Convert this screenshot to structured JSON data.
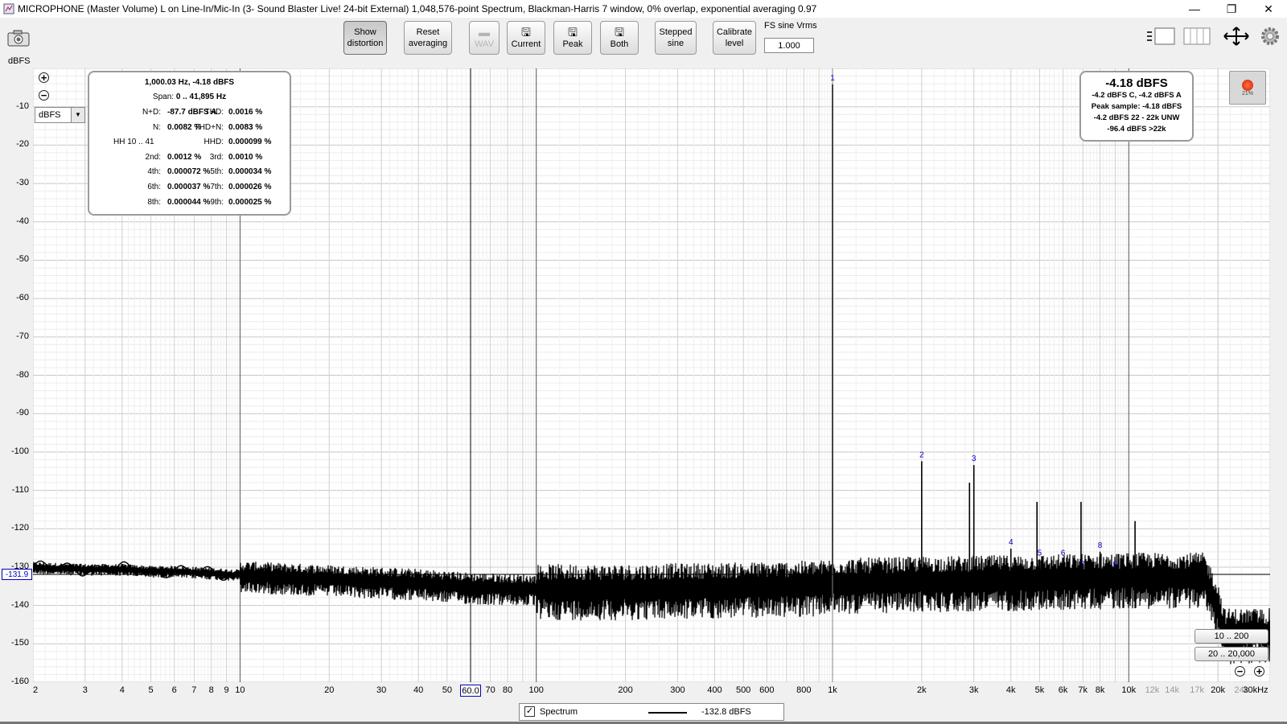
{
  "window": {
    "title": "MICROPHONE (Master Volume) L on Line-In/Mic-In (3- Sound Blaster Live! 24-bit External) 1,048,576-point Spectrum, Blackman-Harris 7 window, 0% overlap, exponential averaging 0.97",
    "minimize": "—",
    "restore": "❐",
    "close": "✕"
  },
  "toolbar": {
    "show_distortion": [
      "Show",
      "distortion"
    ],
    "reset_averaging": [
      "Reset",
      "averaging"
    ],
    "wav": "WAV",
    "current": "Current",
    "peak": "Peak",
    "both": "Both",
    "stepped_sine": [
      "Stepped",
      "sine"
    ],
    "calibrate_level": [
      "Calibrate",
      "level"
    ],
    "fs_label": "FS sine Vrms",
    "fs_value": "1.000"
  },
  "distortion": {
    "header1": "1,000.03 Hz, -4.18 dBFS",
    "header2_label": "Span: ",
    "header2_value": "0 .. 41,895 Hz",
    "rows": [
      {
        "l": "N+D:",
        "v": "-87.7 dBFS A",
        "l2": "THD:",
        "v2": "0.0016 %"
      },
      {
        "l": "N:",
        "v": "0.0082 %",
        "l2": "THD+N:",
        "v2": "0.0083 %"
      },
      {
        "l": "HH 10 .. 41",
        "v": "",
        "l2": "HHD:",
        "v2": "0.000099 %"
      },
      {
        "l": "2nd:",
        "v": "0.0012 %",
        "l2": "3rd:",
        "v2": "0.0010 %"
      },
      {
        "l": "4th:",
        "v": "0.000072 %",
        "l2": "5th:",
        "v2": "0.000034 %"
      },
      {
        "l": "6th:",
        "v": "0.000037 %",
        "l2": "7th:",
        "v2": "0.000026 %"
      },
      {
        "l": "8th:",
        "v": "0.000044 %",
        "l2": "9th:",
        "v2": "0.000025 %"
      }
    ]
  },
  "level": {
    "main": "-4.18 dBFS",
    "lines": [
      "-4.2 dBFS C, -4.2 dBFS A",
      "Peak sample: -4.18 dBFS",
      "-4.2 dBFS 22 - 22k UNW",
      "-96.4 dBFS >22k"
    ]
  },
  "record_pct": "21%",
  "unit_select": "dBFS",
  "ranges": [
    "10 .. 200",
    "20 .. 20,000"
  ],
  "cursor": {
    "y_value": "-131.9",
    "x_value": "60.0"
  },
  "legend": {
    "name": "Spectrum",
    "value": "-132.8 dBFS"
  },
  "chart_data": {
    "type": "line",
    "xscale": "log",
    "ylabel": "dBFS",
    "xlim": [
      2,
      30000
    ],
    "ylim": [
      -160,
      0
    ],
    "grid": true,
    "y_ticks": [
      -10,
      -20,
      -30,
      -40,
      -50,
      -60,
      -70,
      -80,
      -90,
      -100,
      -110,
      -120,
      -130,
      -140,
      -150,
      -160
    ],
    "x_ticks": [
      {
        "v": 2,
        "t": "2"
      },
      {
        "v": 3,
        "t": "3"
      },
      {
        "v": 4,
        "t": "4"
      },
      {
        "v": 5,
        "t": "5"
      },
      {
        "v": 6,
        "t": "6"
      },
      {
        "v": 7,
        "t": "7"
      },
      {
        "v": 8,
        "t": "8"
      },
      {
        "v": 9,
        "t": "9"
      },
      {
        "v": 10,
        "t": "10"
      },
      {
        "v": 20,
        "t": "20"
      },
      {
        "v": 30,
        "t": "30"
      },
      {
        "v": 40,
        "t": "40"
      },
      {
        "v": 50,
        "t": "50"
      },
      {
        "v": 70,
        "t": "70"
      },
      {
        "v": 80,
        "t": "80"
      },
      {
        "v": 100,
        "t": "100"
      },
      {
        "v": 200,
        "t": "200"
      },
      {
        "v": 300,
        "t": "300"
      },
      {
        "v": 400,
        "t": "400"
      },
      {
        "v": 500,
        "t": "500"
      },
      {
        "v": 600,
        "t": "600"
      },
      {
        "v": 800,
        "t": "800"
      },
      {
        "v": 1000,
        "t": "1k"
      },
      {
        "v": 2000,
        "t": "2k"
      },
      {
        "v": 3000,
        "t": "3k"
      },
      {
        "v": 4000,
        "t": "4k"
      },
      {
        "v": 5000,
        "t": "5k"
      },
      {
        "v": 6000,
        "t": "6k"
      },
      {
        "v": 7000,
        "t": "7k"
      },
      {
        "v": 8000,
        "t": "8k"
      },
      {
        "v": 10000,
        "t": "10k"
      },
      {
        "v": 12000,
        "t": "12k",
        "grey": true
      },
      {
        "v": 14000,
        "t": "14k",
        "grey": true
      },
      {
        "v": 17000,
        "t": "17k",
        "grey": true
      },
      {
        "v": 20000,
        "t": "20k"
      },
      {
        "v": 24000,
        "t": "24k",
        "grey": true
      },
      {
        "v": 30000,
        "t": "30kHz"
      }
    ],
    "series": [
      {
        "name": "Spectrum",
        "floor": [
          [
            2,
            -130
          ],
          [
            3,
            -130.5
          ],
          [
            4,
            -130.5
          ],
          [
            5,
            -131
          ],
          [
            6,
            -131
          ],
          [
            8,
            -131.5
          ],
          [
            10,
            -132
          ],
          [
            20,
            -133
          ],
          [
            40,
            -134
          ],
          [
            60,
            -135
          ],
          [
            100,
            -135.5
          ],
          [
            200,
            -135.5
          ],
          [
            500,
            -135
          ],
          [
            900,
            -134.5
          ],
          [
            1000,
            -134
          ],
          [
            2000,
            -133.5
          ],
          [
            5000,
            -133
          ],
          [
            10000,
            -132.5
          ],
          [
            18000,
            -132.5
          ],
          [
            20000,
            -140
          ],
          [
            21000,
            -147
          ],
          [
            30000,
            -147
          ]
        ],
        "peaks": [
          {
            "f": 1000,
            "db": -4.18,
            "label": "1"
          },
          {
            "f": 2000,
            "db": -102.4,
            "label": "2"
          },
          {
            "f": 3000,
            "db": -103.4,
            "label": "3"
          },
          {
            "f": 4000,
            "db": -125.2,
            "label": "4"
          },
          {
            "f": 5000,
            "db": -128.0,
            "label": "5"
          },
          {
            "f": 6000,
            "db": -128.0,
            "label": "6"
          },
          {
            "f": 7000,
            "db": -131.0,
            "label": "7"
          },
          {
            "f": 8000,
            "db": -126.0,
            "label": "8"
          },
          {
            "f": 9000,
            "db": -131.0,
            "label": "9"
          }
        ],
        "spurs": [
          [
            2900,
            -108
          ],
          [
            4900,
            -113
          ],
          [
            6900,
            -113
          ],
          [
            10500,
            -118
          ]
        ]
      }
    ],
    "cursor_x": 60,
    "cursor_y": -131.9
  }
}
